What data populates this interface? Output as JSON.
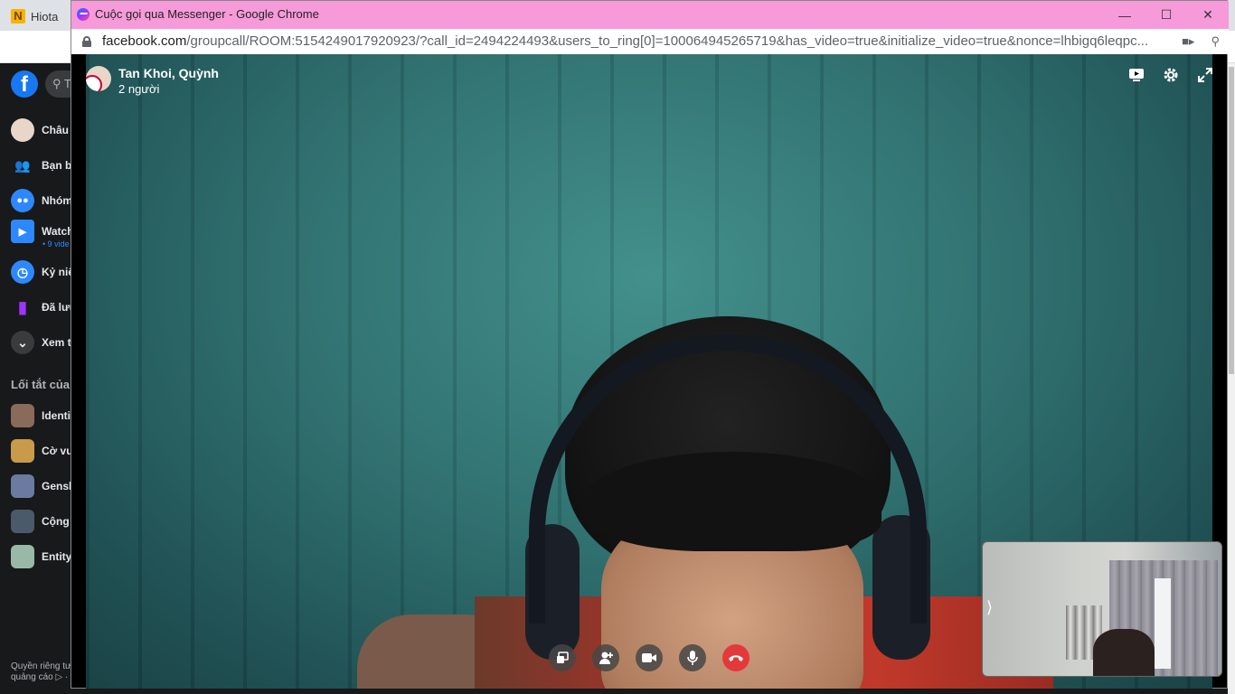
{
  "background": {
    "tab_title": "Hiota",
    "fb_logo": "f",
    "search_placeholder": "T",
    "sidebar": [
      {
        "label": "Châu",
        "icon": "avatar"
      },
      {
        "label": "Bạn b",
        "icon": "friends-icon"
      },
      {
        "label": "Nhóm",
        "icon": "groups-icon"
      },
      {
        "label": "Watch",
        "icon": "watch-icon",
        "sub": "• 9 vide"
      },
      {
        "label": "Kỷ niệ",
        "icon": "memories-icon"
      },
      {
        "label": "Đã lưu",
        "icon": "saved-icon"
      },
      {
        "label": "Xem t",
        "icon": "chevron-down-icon"
      }
    ],
    "shortcuts_heading": "Lối tắt của",
    "shortcuts": [
      "Identi",
      "Cờ vu",
      "Gensh",
      "Cộng",
      "Entity"
    ],
    "footer_line1": "Quyền riêng tư",
    "footer_line2": "quảng cáo ▷ ·"
  },
  "popup": {
    "window_title": "Cuộc gọi qua Messenger - Google Chrome",
    "url_host": "facebook.com",
    "url_path": "/groupcall/ROOM:5154249017920923/?call_id=2494224493&users_to_ring[0]=100064945265719&has_video=true&initialize_video=true&nonce=lhbigq6leqpc..."
  },
  "call": {
    "participants": "Tan Khoi, Quỳnh",
    "count": "2 người",
    "self_toggle": "⟩"
  },
  "colors": {
    "popup_titlebar": "#f79ad9",
    "end_call": "#e4393b",
    "fb_blue": "#1877f2"
  }
}
